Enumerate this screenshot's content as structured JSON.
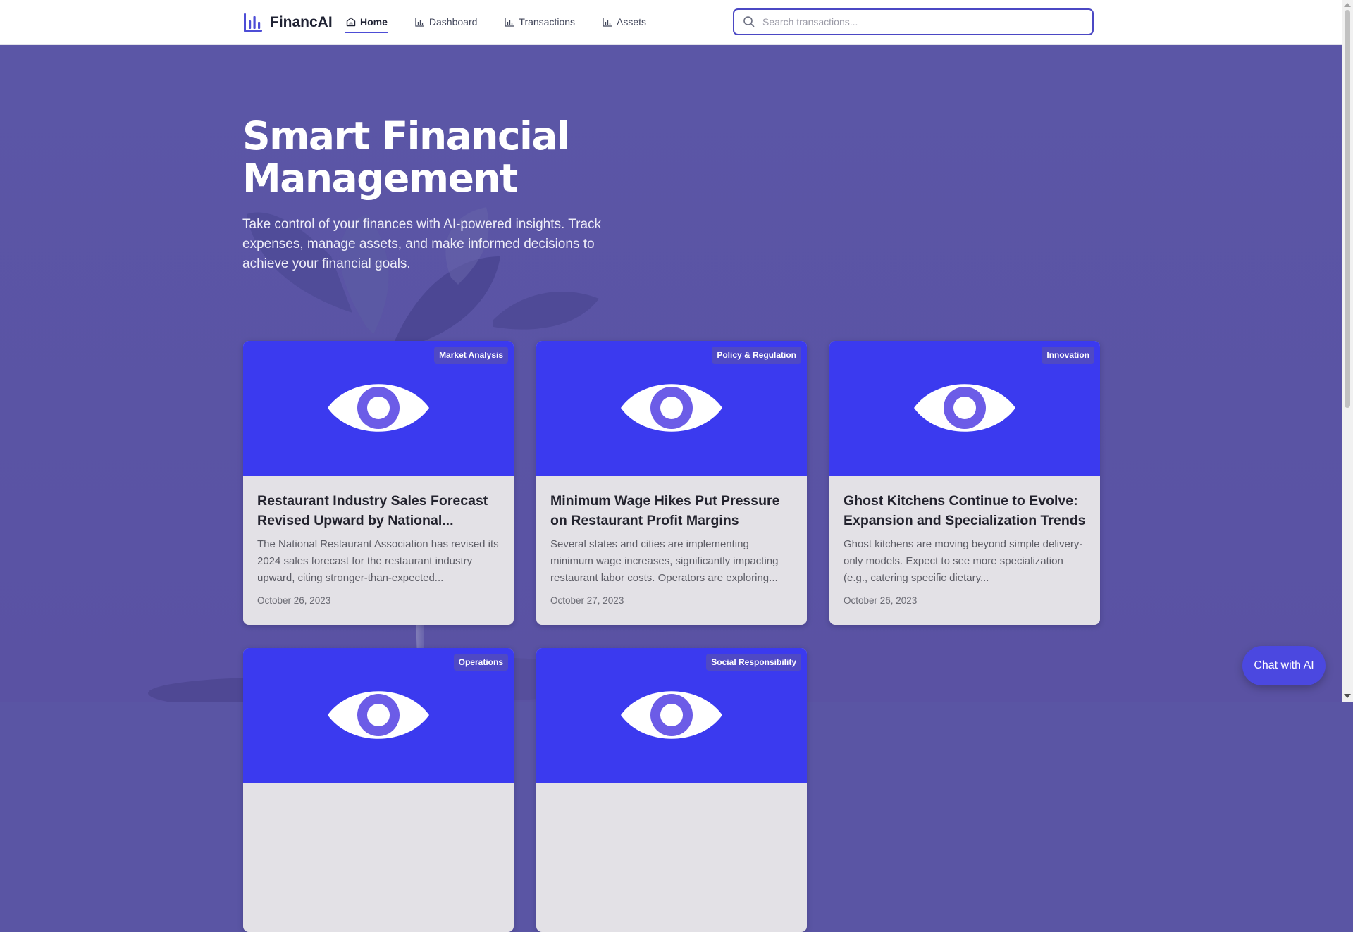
{
  "brand": {
    "name": "FinancAI",
    "logo_icon": "bar-chart-icon",
    "accent_color": "#4d4dd6"
  },
  "nav": {
    "items": [
      {
        "label": "Home",
        "icon": "home-icon",
        "active": true
      },
      {
        "label": "Dashboard",
        "icon": "bar-chart-icon",
        "active": false
      },
      {
        "label": "Transactions",
        "icon": "bar-chart-icon",
        "active": false
      },
      {
        "label": "Assets",
        "icon": "bar-chart-icon",
        "active": false
      }
    ]
  },
  "search": {
    "placeholder": "Search transactions...",
    "value": "",
    "icon": "search-icon"
  },
  "hero": {
    "title_line1": "Smart Financial",
    "title_line2": "Management",
    "subtitle": "Take control of your finances with AI-powered insights. Track expenses, manage assets, and make informed decisions to achieve your financial goals."
  },
  "cards": [
    {
      "tag": "Market Analysis",
      "title": "Restaurant Industry Sales Forecast Revised Upward by National...",
      "description": "The National Restaurant Association has revised its 2024 sales forecast for the restaurant industry upward, citing stronger-than-expected...",
      "date": "October 26, 2023",
      "image_icon": "eye-icon"
    },
    {
      "tag": "Policy & Regulation",
      "title": "Minimum Wage Hikes Put Pressure on Restaurant Profit Margins",
      "description": "Several states and cities are implementing minimum wage increases, significantly impacting restaurant labor costs. Operators are exploring...",
      "date": "October 27, 2023",
      "image_icon": "eye-icon"
    },
    {
      "tag": "Innovation",
      "title": "Ghost Kitchens Continue to Evolve: Expansion and Specialization Trends",
      "description": "Ghost kitchens are moving beyond simple delivery-only models. Expect to see more specialization (e.g., catering specific dietary...",
      "date": "October 26, 2023",
      "image_icon": "eye-icon"
    },
    {
      "tag": "Operations",
      "image_icon": "eye-icon"
    },
    {
      "tag": "Social Responsibility",
      "image_icon": "eye-icon"
    }
  ],
  "chat": {
    "label": "Chat with AI",
    "color": "#4b48e0"
  },
  "colors": {
    "hero_bg": "#5a55a4",
    "card_image_bg": "#3b3aef",
    "tag_bg": "#4f49c4"
  }
}
